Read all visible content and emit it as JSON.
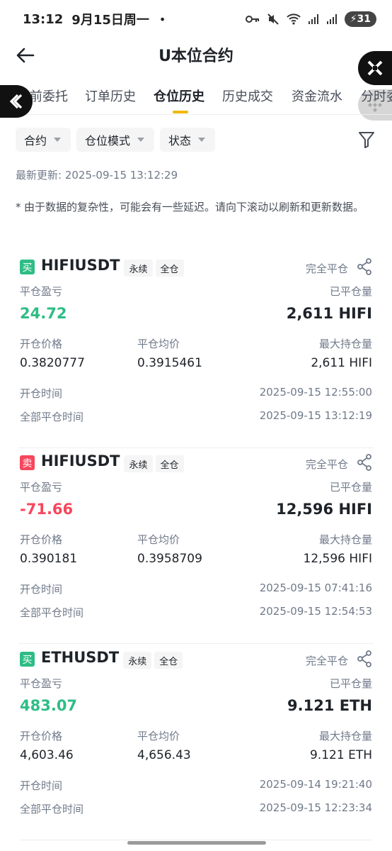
{
  "status_bar": {
    "time": "13:12",
    "date": "9月15日周一",
    "dot": "•",
    "battery": "31"
  },
  "header": {
    "title": "U本位合约"
  },
  "tabs": [
    {
      "label": "前委托"
    },
    {
      "label": "订单历史"
    },
    {
      "label": "仓位历史",
      "active": true
    },
    {
      "label": "历史成交"
    },
    {
      "label": "资金流水"
    },
    {
      "label": "分时委"
    }
  ],
  "filters": [
    {
      "label": "合约"
    },
    {
      "label": "仓位模式"
    },
    {
      "label": "状态"
    }
  ],
  "last_updated": "最新更新: 2025-09-15 13:12:29",
  "notice": {
    "star": "*",
    "text": "由于数据的复杂性，可能会有一些延迟。请向下滚动以刷新和更新数据。"
  },
  "labels": {
    "pnl": "平仓盈亏",
    "closed_qty": "已平仓量",
    "entry_price": "开仓价格",
    "avg_close_price": "平仓均价",
    "max_position": "最大持仓量",
    "open_time": "开仓时间",
    "close_time": "全部平仓时间"
  },
  "positions": [
    {
      "side": "买",
      "side_type": "buy",
      "symbol": "HIFIUSDT",
      "tag_perp": "永续",
      "tag_margin": "全仓",
      "close_type": "完全平仓",
      "pnl": "24.72",
      "pnl_sign": "pos",
      "closed_qty": "2,611 HIFI",
      "entry_price": "0.3820777",
      "avg_close_price": "0.3915461",
      "max_position": "2,611 HIFI",
      "open_time": "2025-09-15 12:55:00",
      "close_time": "2025-09-15 13:12:19"
    },
    {
      "side": "卖",
      "side_type": "sell",
      "symbol": "HIFIUSDT",
      "tag_perp": "永续",
      "tag_margin": "全仓",
      "close_type": "完全平仓",
      "pnl": "-71.66",
      "pnl_sign": "neg",
      "closed_qty": "12,596 HIFI",
      "entry_price": "0.390181",
      "avg_close_price": "0.3958709",
      "max_position": "12,596 HIFI",
      "open_time": "2025-09-15 07:41:16",
      "close_time": "2025-09-15 12:54:53"
    },
    {
      "side": "买",
      "side_type": "buy",
      "symbol": "ETHUSDT",
      "tag_perp": "永续",
      "tag_margin": "全仓",
      "close_type": "完全平仓",
      "pnl": "483.07",
      "pnl_sign": "pos",
      "closed_qty": "9.121 ETH",
      "entry_price": "4,603.46",
      "avg_close_price": "4,656.43",
      "max_position": "9.121 ETH",
      "open_time": "2025-09-14 19:21:40",
      "close_time": "2025-09-15 12:23:34"
    }
  ],
  "colors": {
    "positive": "#2ebd85",
    "negative": "#f6465d",
    "accent": "#f0b90b"
  }
}
